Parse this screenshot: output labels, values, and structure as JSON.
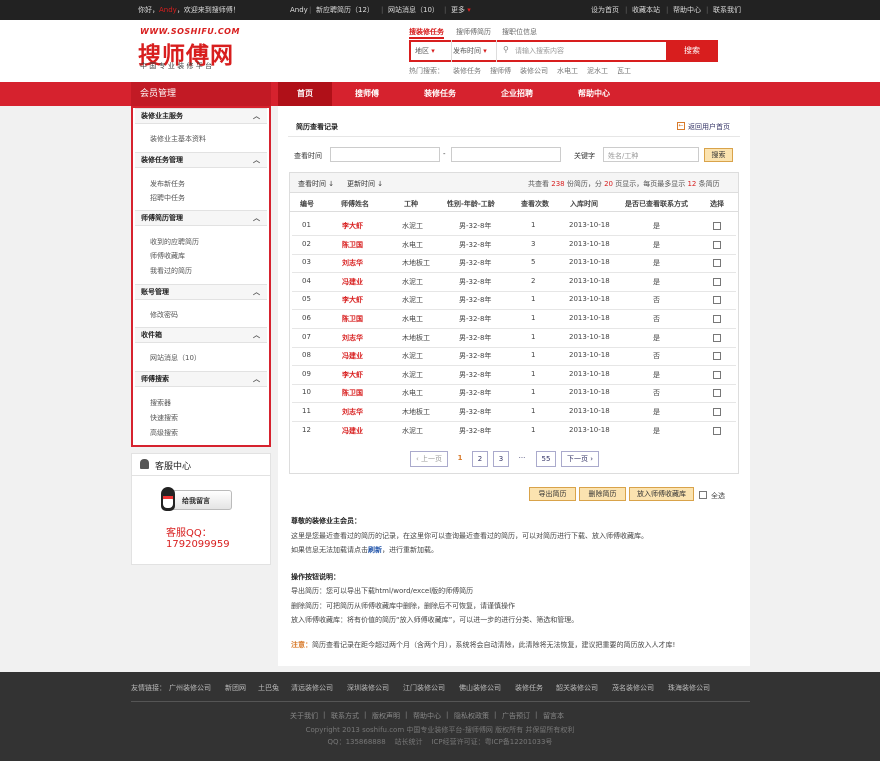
{
  "topbar": {
    "greeting_prefix": "你好，",
    "user": "Andy",
    "greeting_suffix": "，欢迎来到搜师傅！",
    "user2": "Andy",
    "new_resume": "新应聘简历（12）",
    "messages": "网站消息（10）",
    "more": "更多",
    "home": "设为首页",
    "fav": "收藏本站",
    "help": "帮助中心",
    "contact": "联系我们"
  },
  "logo": {
    "url": "WWW.SOSHIFU.COM",
    "name": "搜师傅网",
    "slogan": "中国专业装修平台"
  },
  "search": {
    "tabs": [
      "搜装修任务",
      "搜师傅简历",
      "搜职位信息"
    ],
    "region": "地区",
    "time": "发布时间",
    "placeholder": "请输入搜索内容",
    "button": "搜索",
    "hot_label": "热门搜索：",
    "hot": [
      "装修任务",
      "搜师傅",
      "装修公司",
      "水电工",
      "泥水工",
      "瓦工"
    ]
  },
  "nav": {
    "member": "会员管理",
    "items": [
      "首页",
      "搜师傅",
      "装修任务",
      "企业招聘",
      "帮助中心"
    ]
  },
  "sidebar": {
    "sections": [
      {
        "title": "装修业主服务",
        "items": [
          "装修业主基本资料"
        ]
      },
      {
        "title": "装修任务管理",
        "items": [
          "发布新任务",
          "招聘中任务"
        ]
      },
      {
        "title": "师傅简历管理",
        "items": [
          "收到的应聘简历",
          "师傅收藏库",
          "我看过的简历"
        ]
      },
      {
        "title": "账号管理",
        "items": [
          "修改密码"
        ]
      },
      {
        "title": "收件箱",
        "items": [
          "网站消息（10）"
        ]
      },
      {
        "title": "师傅搜索",
        "items": [
          "搜索器",
          "快速搜索",
          "高级搜索"
        ]
      }
    ]
  },
  "kefu": {
    "title": "客服中心",
    "btn": "给我留言",
    "qq_label": "客服QQ：",
    "qq": "1792099959"
  },
  "main": {
    "title": "简历查看记录",
    "back": "返回用户首页",
    "time_label": "查看时间",
    "dash": "-",
    "kw_label": "关键字",
    "kw_placeholder": "姓名/工种",
    "search_btn": "搜索",
    "sort1": "查看时间",
    "sort2": "更新时间",
    "summary_a": "共查看",
    "total": "238",
    "summary_b": "份简历，分",
    "pages": "20",
    "summary_c": "页显示，每页最多显示",
    "per": "12",
    "summary_d": "条简历"
  },
  "table": {
    "headers": [
      "编号",
      "师傅姓名",
      "工种",
      "性别-年龄-工龄",
      "查看次数",
      "入库时间",
      "是否已查看联系方式",
      "选择"
    ],
    "rows": [
      [
        "01",
        "李大虾",
        "水泥工",
        "男-32-8年",
        "1",
        "2013-10-18",
        "是"
      ],
      [
        "02",
        "陈卫国",
        "水电工",
        "男-32-8年",
        "3",
        "2013-10-18",
        "是"
      ],
      [
        "03",
        "刘志华",
        "木地板工",
        "男-32-8年",
        "5",
        "2013-10-18",
        "是"
      ],
      [
        "04",
        "冯建业",
        "水泥工",
        "男-32-8年",
        "2",
        "2013-10-18",
        "是"
      ],
      [
        "05",
        "李大虾",
        "水泥工",
        "男-32-8年",
        "1",
        "2013-10-18",
        "否"
      ],
      [
        "06",
        "陈卫国",
        "水电工",
        "男-32-8年",
        "1",
        "2013-10-18",
        "否"
      ],
      [
        "07",
        "刘志华",
        "木地板工",
        "男-32-8年",
        "1",
        "2013-10-18",
        "是"
      ],
      [
        "08",
        "冯建业",
        "水泥工",
        "男-32-8年",
        "1",
        "2013-10-18",
        "否"
      ],
      [
        "09",
        "李大虾",
        "水泥工",
        "男-32-8年",
        "1",
        "2013-10-18",
        "是"
      ],
      [
        "10",
        "陈卫国",
        "水电工",
        "男-32-8年",
        "1",
        "2013-10-18",
        "否"
      ],
      [
        "11",
        "刘志华",
        "木地板工",
        "男-32-8年",
        "1",
        "2013-10-18",
        "是"
      ],
      [
        "12",
        "冯建业",
        "水泥工",
        "男-32-8年",
        "1",
        "2013-10-18",
        "是"
      ]
    ]
  },
  "pager": {
    "prev": "上一页",
    "pages": [
      "1",
      "2",
      "3"
    ],
    "ellipsis": "···",
    "last": "55",
    "next": "下一页"
  },
  "actions": {
    "export": "导出简历",
    "delete": "删除简历",
    "store": "放入师傅收藏库",
    "all": "全选"
  },
  "notes": {
    "h1": "尊敬的装修业主会员：",
    "p1": "这里是您最近查看过的简历的记录，在这里你可以查询最近查看过的简历，可以对简历进行下载、放入师傅收藏库。",
    "p2a": "如果信息无法加载请点击",
    "p2link": "刷新",
    "p2b": "，进行重新加载。",
    "h2": "操作按钮说明：",
    "l1": "导出简历：您可以导出下载html/word/excel版的师傅简历",
    "l2": "删除简历：可把简历从师傅收藏库中删除，删除后不可恢复，请谨慎操作",
    "l3": "放入师傅收藏库：将有价值的简历“放入师傅收藏库”，可以进一步的进行分类、筛选和管理。",
    "warn": "注意：",
    "warn_text": "简历查看记录在距今超过两个月（含两个月），系统将会自动清除，此清除将无法恢复，建议把重要的简历放入人才库!"
  },
  "footer": {
    "friend_label": "友情链接：",
    "links": [
      "广州装修公司",
      "新团网",
      "土巴兔",
      "清远装修公司",
      "深圳装修公司",
      "江门装修公司",
      "佛山装修公司",
      "装修任务",
      "韶关装修公司",
      "茂名装修公司",
      "珠海装修公司"
    ],
    "bottom": [
      "关于我们",
      "联系方式",
      "版权声明",
      "帮助中心",
      "隐私权政策",
      "广告预订",
      "留言本"
    ],
    "copy": "Copyright 2013 soshifu.com  中国专业装修平台-搜师傅网 版权所有 并保留所有权利",
    "icp": "QQ：135868888    站长统计    ICP经营许可证：粤ICP备12201033号"
  }
}
